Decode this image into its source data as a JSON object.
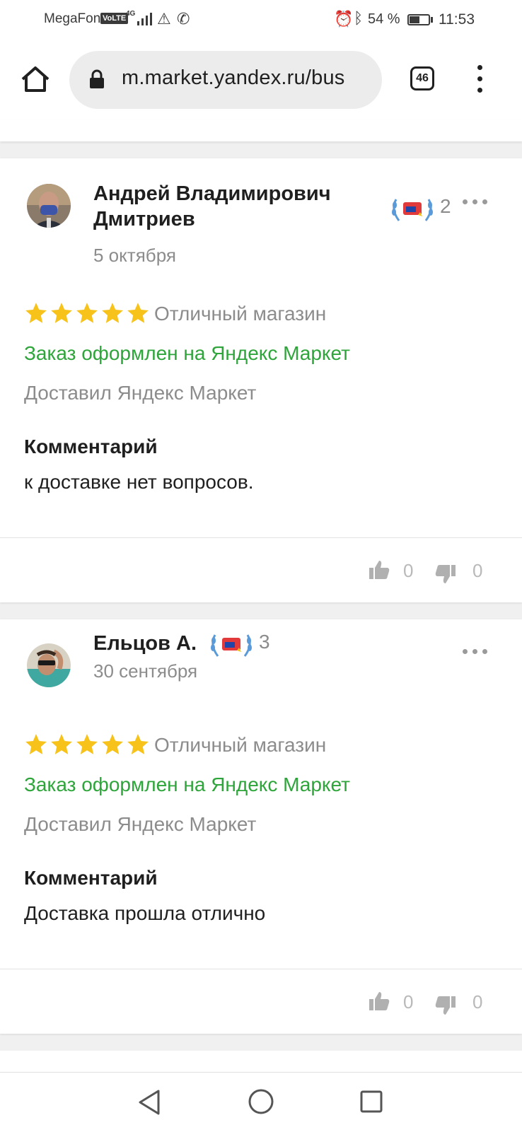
{
  "status_bar": {
    "carrier": "MegaFon",
    "volte": "VoLTE",
    "network": "4G",
    "battery_percent": "54 %",
    "battery_level": 0.54,
    "time": "11:53"
  },
  "browser": {
    "url": "m.market.yandex.ru/bus",
    "tab_count": "46",
    "icons": [
      "home-icon",
      "lock-icon",
      "tabs-icon",
      "menu-icon"
    ]
  },
  "colors": {
    "accent_green": "#2ea53a",
    "star_yellow": "#f7c21a",
    "muted_text": "#8c8c8c",
    "primary_text": "#1f1f1f"
  },
  "reviews": [
    {
      "author": "Андрей Владимирович Дмитриев",
      "author_line1": "Андрей Владимирович",
      "author_line2": "Дмитриев",
      "date": "5 октября",
      "badge_count": "2",
      "stars": 5,
      "rating_text": "Отличный магазин",
      "order_text": "Заказ оформлен на Яндекс Маркет",
      "delivery_text": "Доставил Яндекс Маркет",
      "comment_label": "Комментарий",
      "comment": "к доставке нет вопросов.",
      "likes": "0",
      "dislikes": "0"
    },
    {
      "author": "Ельцов А.",
      "date": "30 сентября",
      "badge_count": "3",
      "stars": 5,
      "rating_text": "Отличный магазин",
      "order_text": "Заказ оформлен на Яндекс Маркет",
      "delivery_text": "Доставил Яндекс Маркет",
      "comment_label": "Комментарий",
      "comment": "Доставка прошла отлично",
      "likes": "0",
      "dislikes": "0"
    }
  ],
  "nav_bar": {
    "icons": [
      "back-icon",
      "home-circle-icon",
      "recents-icon"
    ]
  }
}
